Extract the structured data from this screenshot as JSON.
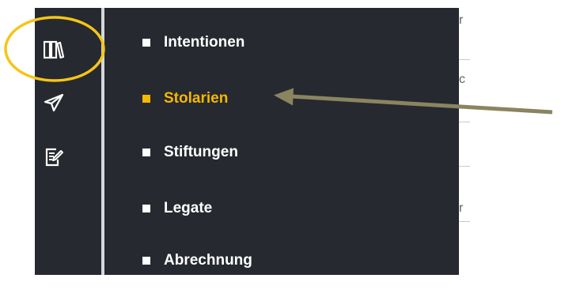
{
  "sidebar": {
    "icons": [
      {
        "name": "books-icon"
      },
      {
        "name": "paper-plane-icon"
      },
      {
        "name": "edit-note-icon"
      }
    ]
  },
  "menu": {
    "items": [
      {
        "label": "Intentionen",
        "active": false
      },
      {
        "label": "Stolarien",
        "active": true
      },
      {
        "label": "Stiftungen",
        "active": false
      },
      {
        "label": "Legate",
        "active": false
      },
      {
        "label": "Abrechnung",
        "active": false
      }
    ]
  },
  "annotations": {
    "highlight_color": "#f5c518",
    "arrow_color": "#8a8560"
  },
  "background_fragments": {
    "texts": [
      "r",
      "c",
      "r"
    ]
  },
  "colors": {
    "sidebar_bg": "#26292f",
    "accent": "#f5b800",
    "text": "#ffffff"
  }
}
